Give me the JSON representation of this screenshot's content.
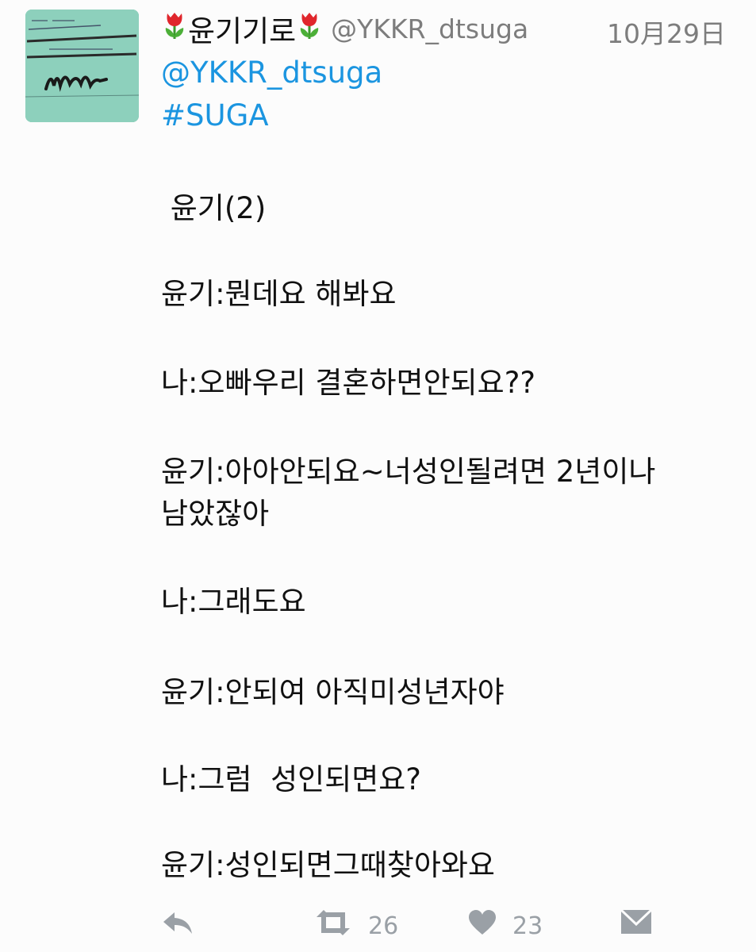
{
  "tweet": {
    "display_name": "윤기기로",
    "handle": "@YKKR_dtsuga",
    "date": "10月29日",
    "mention": "@YKKR_dtsuga",
    "hashtag": "#SUGA",
    "lines": [
      " 윤기(2)",
      "윤기:뭔데요 해봐요",
      "나:오빠우리 결혼하면안되요??",
      "윤기:아아안되요~너성인될려면 2년이나\n남았잖아",
      "나:그래도요",
      "윤기:안되여 아직미성년자야",
      "나:그럼  성인되면요?",
      "윤기:성인되면그때찾아와요"
    ],
    "retweet_count": "26",
    "like_count": "23",
    "name_decoration_icon": "tulip-icon"
  },
  "colors": {
    "link": "#1b95e0",
    "muted": "#7d7d7d",
    "action_icon": "#9aa0a6"
  }
}
